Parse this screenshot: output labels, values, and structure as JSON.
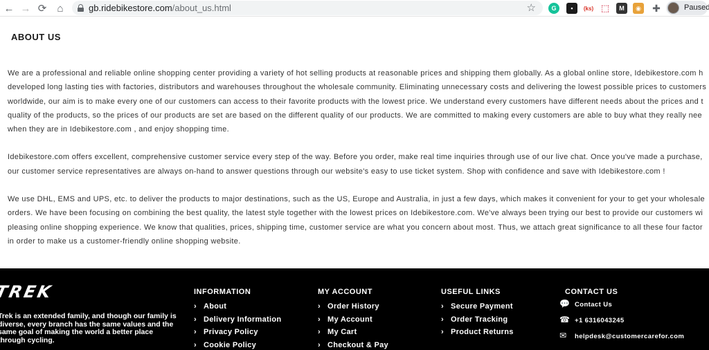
{
  "browser": {
    "url_domain": "gb.ridebikestore.com",
    "url_path": "/about_us.html",
    "profile_status": "Paused",
    "extension_label_3": "(ks)"
  },
  "page": {
    "title": "ABOUT US",
    "paragraphs": [
      [
        "We are a professional and reliable online shopping center providing a variety of hot selling products at reasonable prices and shipping them globally. As a global online store, Idebikestore.com h",
        "developed long lasting ties with factories, distributors and warehouses throughout the wholesale community. Eliminating unnecessary costs and delivering the lowest possible prices to customers",
        "worldwide, our aim is to make every one of our customers can access to their favorite products with the lowest price. We understand every customers have different needs about the prices and t",
        "quality of the products, so the prices of our products are set are based on the different quality of our products. We are committed to making every customers are able to buy what they really nee",
        "when they are in Idebikestore.com , and enjoy shopping time."
      ],
      [
        "Idebikestore.com offers excellent, comprehensive customer service every step of the way. Before you order, make real time inquiries through use of our live chat. Once you've made a purchase,",
        "our customer service representatives are always on-hand to answer questions through our website's easy to use ticket system. Shop with confidence and save with Idebikestore.com !"
      ],
      [
        "We use DHL, EMS and UPS, etc. to deliver the products to major destinations, such as the US, Europe and Australia, in just a few days, which makes it convenient for your to get your wholesale",
        "orders. We have been focusing on combining the best quality, the latest style together with the lowest prices on Idebikestore.com. We've always been trying our best to provide our customers wi",
        "pleasing online shopping experience. We know that qualities, prices, shipping time, customer service are what you concern about most. Thus, we attach great significance to all these four factor",
        "in order to make us a customer-friendly online shopping website."
      ]
    ]
  },
  "footer": {
    "brand": "TREK",
    "brand_description": "Trek is an extended family, and though our family is diverse, every branch has the same values and the same goal of making the world a better place through cycling.",
    "information": {
      "title": "INFORMATION",
      "items": [
        "About",
        "Delivery Information",
        "Privacy Policy",
        "Cookie Policy"
      ]
    },
    "my_account": {
      "title": "MY ACCOUNT",
      "items": [
        "Order History",
        "My Account",
        "My Cart",
        "Checkout & Pay"
      ]
    },
    "useful_links": {
      "title": "USEFUL LINKS",
      "items": [
        "Secure Payment",
        "Order Tracking",
        "Product Returns"
      ]
    },
    "contact": {
      "title": "CONTACT US",
      "items": [
        {
          "icon": "chat-icon",
          "label": "Contact Us"
        },
        {
          "icon": "phone-icon",
          "label": "+1 6316043245"
        },
        {
          "icon": "email-icon",
          "label": "helpdesk@customercarefor.com"
        }
      ]
    }
  },
  "colors": {
    "footer_bg": "#000000",
    "body_text": "#333333"
  }
}
